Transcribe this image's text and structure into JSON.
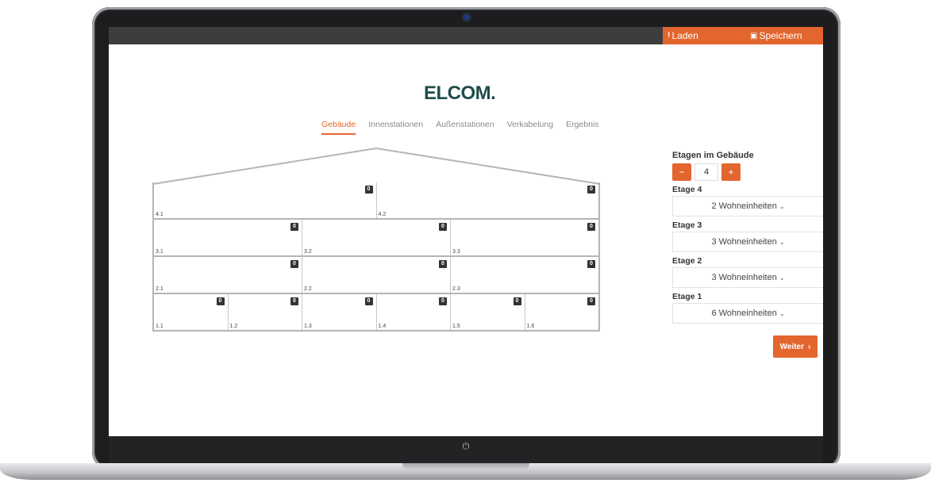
{
  "topbar": {
    "load_label": "Laden",
    "load_icon": "upload-icon",
    "save_label": "Speichern",
    "save_icon": "floppy-disk-icon"
  },
  "brand": {
    "logo_text": "ELCOM."
  },
  "tabs": [
    {
      "label": "Gebäude",
      "active": true
    },
    {
      "label": "Innenstationen",
      "active": false
    },
    {
      "label": "Außenstationen",
      "active": false
    },
    {
      "label": "Verkabelung",
      "active": false
    },
    {
      "label": "Ergebnis",
      "active": false
    }
  ],
  "building": {
    "floors": [
      {
        "units": [
          {
            "label": "4.1",
            "count": "0"
          },
          {
            "label": "4.2",
            "count": "0"
          }
        ]
      },
      {
        "units": [
          {
            "label": "3.1",
            "count": "0"
          },
          {
            "label": "3.2",
            "count": "0"
          },
          {
            "label": "3.3",
            "count": "0"
          }
        ]
      },
      {
        "units": [
          {
            "label": "2.1",
            "count": "0"
          },
          {
            "label": "2.2",
            "count": "0"
          },
          {
            "label": "2.3",
            "count": "0"
          }
        ]
      },
      {
        "units": [
          {
            "label": "1.1",
            "count": "0"
          },
          {
            "label": "1.2",
            "count": "0"
          },
          {
            "label": "1.3",
            "count": "0"
          },
          {
            "label": "1.4",
            "count": "0"
          },
          {
            "label": "1.5",
            "count": "0"
          },
          {
            "label": "1.6",
            "count": "0"
          }
        ]
      }
    ]
  },
  "panel": {
    "title": "Etagen im Gebäude",
    "minus": "−",
    "plus": "+",
    "floor_count": "4",
    "floors": [
      {
        "label": "Etage 4",
        "value": "2 Wohneinheiten"
      },
      {
        "label": "Etage 3",
        "value": "3 Wohneinheiten"
      },
      {
        "label": "Etage 2",
        "value": "3 Wohneinheiten"
      },
      {
        "label": "Etage 1",
        "value": "6 Wohneinheiten"
      }
    ],
    "next_label": "Weiter"
  },
  "colors": {
    "accent": "#e2662e",
    "brand": "#1f4d4a",
    "topbar": "#3d3d3f"
  }
}
